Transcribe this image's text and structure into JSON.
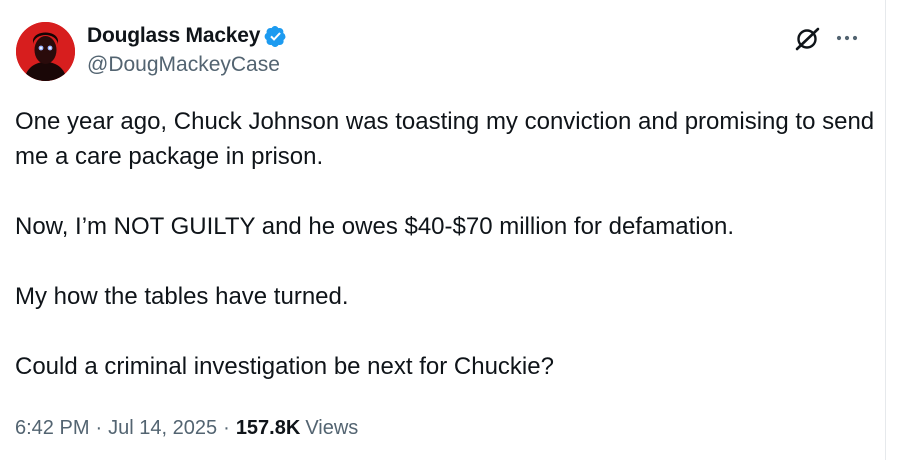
{
  "author": {
    "display_name": "Douglass Mackey",
    "handle": "@DougMackeyCase",
    "verified": true,
    "verified_color": "#1d9bf0"
  },
  "actions": {
    "grok_icon": "grok-icon",
    "more_icon": "more-options-icon"
  },
  "tweet": {
    "paragraphs": [
      "One year ago, Chuck Johnson was toasting my conviction and promising to send me a care package in prison.",
      "Now, I’m NOT GUILTY and he owes $40-$70 million for defamation.",
      "My how the tables have turned.",
      "Could a criminal investigation be next for Chuckie?"
    ]
  },
  "meta": {
    "time": "6:42 PM",
    "separator": "·",
    "date": "Jul 14, 2025",
    "views_count": "157.8K",
    "views_label": "Views"
  },
  "colors": {
    "text": "#0f1419",
    "secondary": "#536471",
    "avatar_bg": "#d91a1a"
  }
}
